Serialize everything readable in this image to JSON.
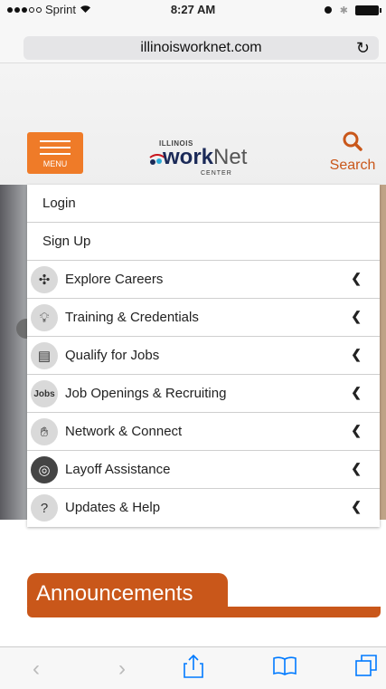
{
  "status": {
    "carrier": "Sprint",
    "time": "8:27 AM"
  },
  "browser": {
    "url": "illinoisworknet.com",
    "reload_icon": "reload-icon"
  },
  "header": {
    "menu_label": "MENU",
    "logo": {
      "top": "ILLINOIS",
      "work": "work",
      "net": "Net",
      "center": "CENTER"
    },
    "search_label": "Search"
  },
  "menu": {
    "items": [
      {
        "label": "Login",
        "icon": ""
      },
      {
        "label": "Sign Up",
        "icon": ""
      },
      {
        "label": "Explore Careers",
        "icon": "compass-icon"
      },
      {
        "label": "Training & Credentials",
        "icon": "lightbulb-icon"
      },
      {
        "label": "Qualify for Jobs",
        "icon": "clipboard-icon"
      },
      {
        "label": "Job Openings & Recruiting",
        "icon": "jobs-icon"
      },
      {
        "label": "Network & Connect",
        "icon": "handshake-icon"
      },
      {
        "label": "Layoff Assistance",
        "icon": "lifebuoy-icon"
      },
      {
        "label": "Updates & Help",
        "icon": "help-person-icon"
      }
    ]
  },
  "announcements": {
    "title": "Announcements"
  },
  "colors": {
    "accent": "#ef7b28",
    "search": "#c9571a",
    "ios_blue": "#007aff"
  }
}
